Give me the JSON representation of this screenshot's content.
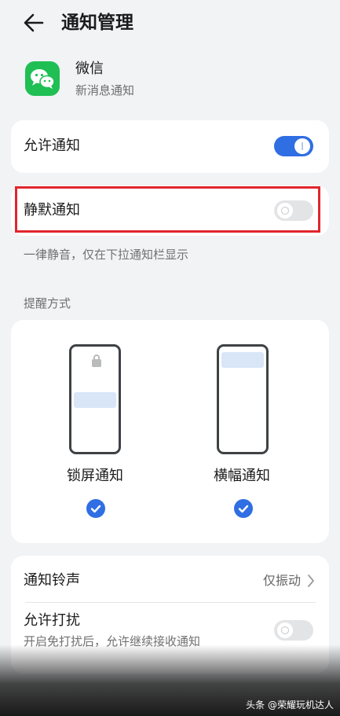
{
  "header": {
    "title": "通知管理"
  },
  "app": {
    "name": "微信",
    "subtitle": "新消息通知"
  },
  "allow_notifications": {
    "label": "允许通知",
    "enabled": true
  },
  "silent_notifications": {
    "label": "静默通知",
    "enabled": false,
    "hint": "一律静音，仅在下拉通知栏显示"
  },
  "reminder": {
    "section_label": "提醒方式",
    "options": [
      {
        "label": "锁屏通知",
        "checked": true
      },
      {
        "label": "横幅通知",
        "checked": true
      }
    ]
  },
  "ringtone": {
    "label": "通知铃声",
    "value": "仅振动"
  },
  "dnd": {
    "label": "允许打扰",
    "hint": "开启免打扰后，允许继续接收通知",
    "enabled": false
  },
  "watermark": {
    "text": "头条 @荣耀玩机达人"
  },
  "colors": {
    "accent": "#2f6ee3",
    "highlight": "#e0262d",
    "wechat": "#1fbf53"
  }
}
